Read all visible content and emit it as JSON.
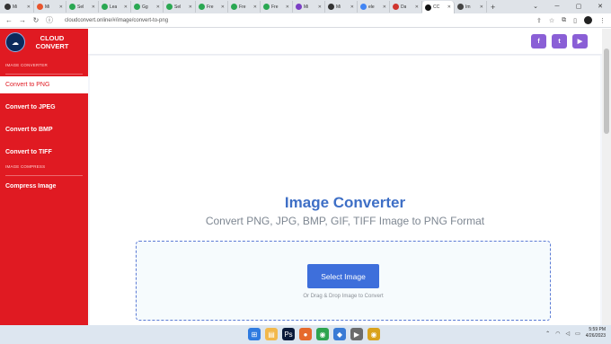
{
  "browser": {
    "tabs": [
      {
        "title": "Mi",
        "color": "#333333"
      },
      {
        "title": "Mi",
        "color": "#e8542c"
      },
      {
        "title": "Sel",
        "color": "#2aa852"
      },
      {
        "title": "Lea",
        "color": "#2aa852"
      },
      {
        "title": "Gg",
        "color": "#2aa852"
      },
      {
        "title": "Sel",
        "color": "#2aa852"
      },
      {
        "title": "Fre",
        "color": "#2aa852"
      },
      {
        "title": "Fre",
        "color": "#2aa852"
      },
      {
        "title": "Fre",
        "color": "#2aa852"
      },
      {
        "title": "Mi",
        "color": "#7b3fc4"
      },
      {
        "title": "Mi",
        "color": "#333333"
      },
      {
        "title": "ele",
        "color": "#4285f4"
      },
      {
        "title": "Da",
        "color": "#d0352e"
      },
      {
        "title": "CC",
        "color": "#111111",
        "active": true
      },
      {
        "title": "Im",
        "color": "#444444"
      }
    ],
    "new_tab_glyph": "+",
    "url": "cloudconvert.online/#/image/convert-to-png",
    "window_controls": [
      "⌄",
      "─",
      "▢",
      "✕"
    ]
  },
  "sidebar": {
    "brand": "CLOUD CONVERT",
    "sections": [
      {
        "label": "IMAGE CONVERTER",
        "items": [
          "Convert to PNG",
          "Convert to JPEG",
          "Convert to BMP",
          "Convert to TIFF"
        ]
      },
      {
        "label": "IMAGE COMPRESS",
        "items": [
          "Compress Image"
        ]
      }
    ],
    "active_item": "Convert to PNG",
    "color": "#e01a22"
  },
  "topbar": {
    "social": [
      {
        "name": "facebook-icon",
        "glyph": "f"
      },
      {
        "name": "twitter-icon",
        "glyph": "t"
      },
      {
        "name": "youtube-icon",
        "glyph": "▶"
      }
    ],
    "accent": "#8a5fd6"
  },
  "main": {
    "title": "Image Converter",
    "subtitle": "Convert PNG, JPG, BMP, GIF, TIFF Image to PNG Format",
    "select_button": "Select Image",
    "drag_text": "Or Drag & Drop Image to Convert",
    "accent": "#3e6fdb"
  },
  "taskbar": {
    "time": "5:59 PM",
    "date": "4/26/2023"
  }
}
